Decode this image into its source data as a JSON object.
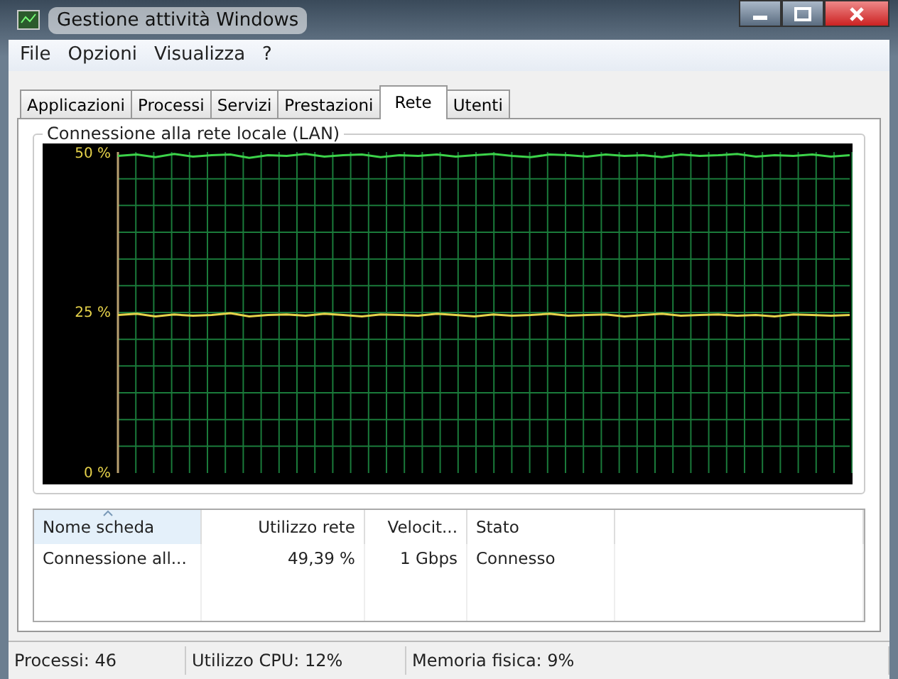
{
  "window": {
    "title": "Gestione attività Windows"
  },
  "menu": [
    "File",
    "Opzioni",
    "Visualizza",
    "?"
  ],
  "tabs": [
    {
      "label": "Applicazioni",
      "selected": false
    },
    {
      "label": "Processi",
      "selected": false
    },
    {
      "label": "Servizi",
      "selected": false
    },
    {
      "label": "Prestazioni",
      "selected": false
    },
    {
      "label": "Rete",
      "selected": true
    },
    {
      "label": "Utenti",
      "selected": false
    }
  ],
  "group": {
    "title": "Connessione alla rete locale (LAN)",
    "chart_data": {
      "type": "line",
      "grid": true,
      "ylim": [
        0,
        50
      ],
      "yticks": [
        {
          "value": 0,
          "label": "0 %"
        },
        {
          "value": 25,
          "label": "25 %"
        },
        {
          "value": 50,
          "label": "50 %"
        }
      ],
      "series": [
        {
          "color": "#3cd24a",
          "values": [
            49.4,
            49.6,
            49.2,
            49.7,
            49.3,
            49.5,
            49.6,
            49.1,
            49.5,
            49.4,
            49.7,
            49.3,
            49.5,
            49.6,
            49.2,
            49.5,
            49.4,
            49.6,
            49.3,
            49.5,
            49.7,
            49.4,
            49.2,
            49.6,
            49.5,
            49.3,
            49.6,
            49.4,
            49.5,
            49.2,
            49.6,
            49.4,
            49.5,
            49.7,
            49.3,
            49.5,
            49.4,
            49.6,
            49.3,
            49.5
          ]
        },
        {
          "color": "#e6d24a",
          "values": [
            24.6,
            24.8,
            24.4,
            24.7,
            24.5,
            24.6,
            24.9,
            24.4,
            24.6,
            24.7,
            24.5,
            24.8,
            24.6,
            24.4,
            24.7,
            24.6,
            24.5,
            24.8,
            24.6,
            24.4,
            24.7,
            24.5,
            24.6,
            24.8,
            24.5,
            24.6,
            24.7,
            24.4,
            24.6,
            24.8,
            24.5,
            24.6,
            24.7,
            24.5,
            24.6,
            24.4,
            24.7,
            24.6,
            24.5,
            24.6
          ]
        }
      ]
    }
  },
  "table": {
    "columns": [
      {
        "label": "Nome scheda",
        "sorted": true
      },
      {
        "label": "Utilizzo rete",
        "sorted": false
      },
      {
        "label": "Velocit...",
        "sorted": false
      },
      {
        "label": "Stato",
        "sorted": false
      }
    ],
    "rows": [
      [
        "Connessione all...",
        "49,39 %",
        "1 Gbps",
        "Connesso"
      ]
    ]
  },
  "status_bar": [
    "Processi: 46",
    "Utilizzo CPU: 12%",
    "Memoria fisica: 9%"
  ]
}
